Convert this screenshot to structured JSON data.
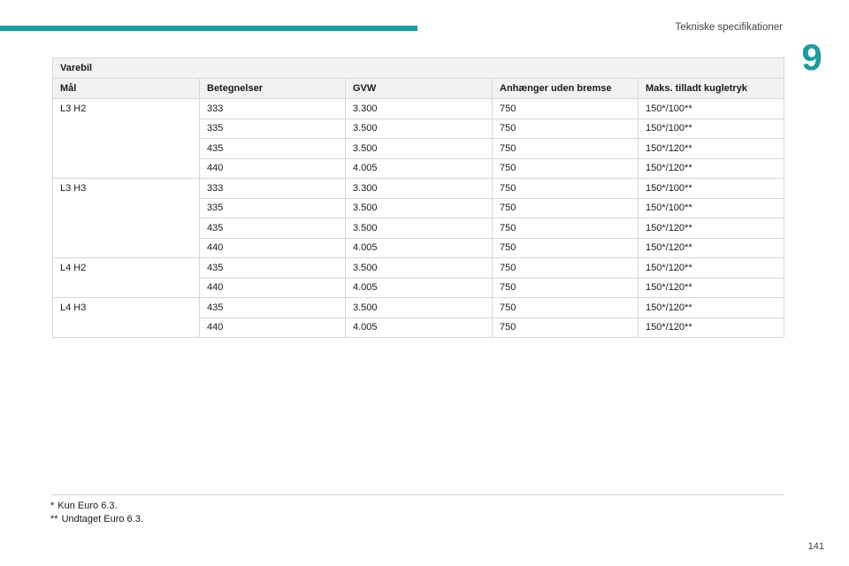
{
  "header": {
    "section_title": "Tekniske specifikationer",
    "chapter_number": "9"
  },
  "table": {
    "caption": "Varebil",
    "columns": [
      "Mål",
      "Betegnelser",
      "GVW",
      "Anhænger uden bremse",
      "Maks. tilladt kugletryk"
    ],
    "groups": [
      {
        "label": "L3 H2",
        "rows": [
          [
            "333",
            "3.300",
            "750",
            "150*/100**"
          ],
          [
            "335",
            "3.500",
            "750",
            "150*/100**"
          ],
          [
            "435",
            "3.500",
            "750",
            "150*/120**"
          ],
          [
            "440",
            "4.005",
            "750",
            "150*/120**"
          ]
        ]
      },
      {
        "label": "L3 H3",
        "rows": [
          [
            "333",
            "3.300",
            "750",
            "150*/100**"
          ],
          [
            "335",
            "3.500",
            "750",
            "150*/100**"
          ],
          [
            "435",
            "3.500",
            "750",
            "150*/120**"
          ],
          [
            "440",
            "4.005",
            "750",
            "150*/120**"
          ]
        ]
      },
      {
        "label": "L4 H2",
        "rows": [
          [
            "435",
            "3.500",
            "750",
            "150*/120**"
          ],
          [
            "440",
            "4.005",
            "750",
            "150*/120**"
          ]
        ]
      },
      {
        "label": "L4 H3",
        "rows": [
          [
            "435",
            "3.500",
            "750",
            "150*/120**"
          ],
          [
            "440",
            "4.005",
            "750",
            "150*/120**"
          ]
        ]
      }
    ]
  },
  "footnotes": [
    {
      "mark": "*",
      "text": "Kun Euro 6.3."
    },
    {
      "mark": "**",
      "text": "Undtaget Euro 6.3."
    }
  ],
  "page_number": "141"
}
